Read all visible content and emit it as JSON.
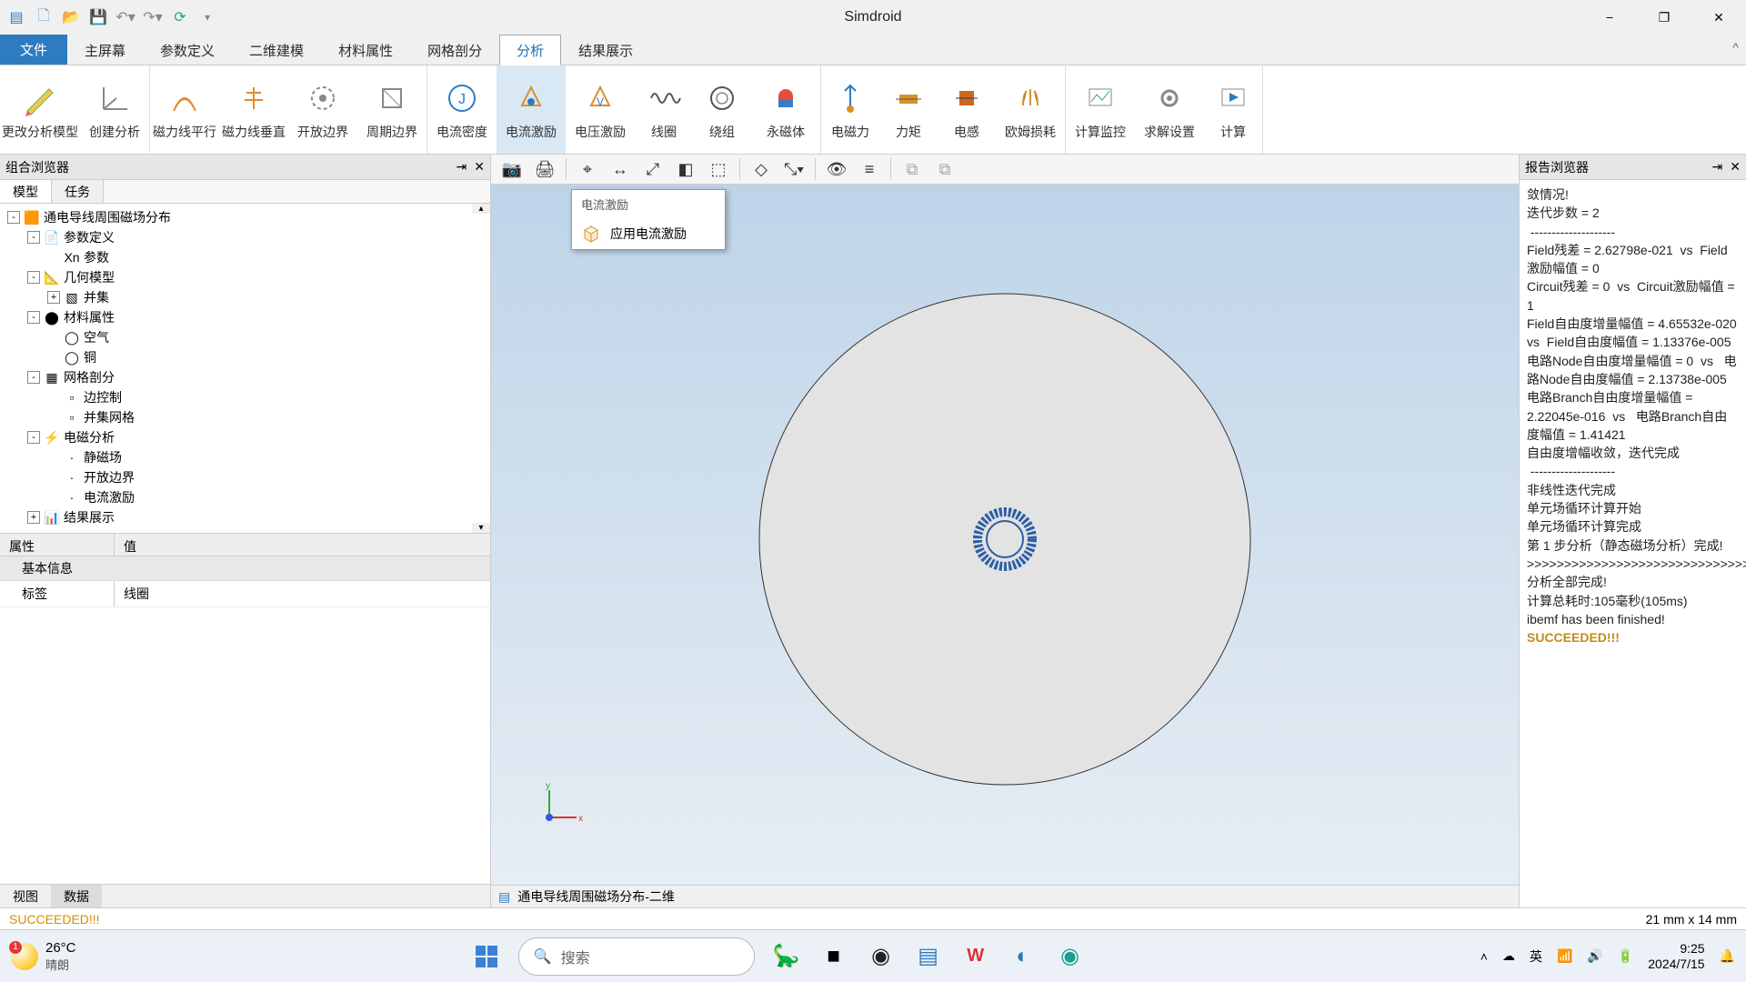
{
  "app": {
    "title": "Simdroid"
  },
  "qat": [
    "logo",
    "new",
    "open",
    "save",
    "undo",
    "redo",
    "refresh",
    "more"
  ],
  "menus": {
    "file": "文件",
    "items": [
      "主屏幕",
      "参数定义",
      "二维建模",
      "材料属性",
      "网格剖分",
      "分析",
      "结果展示"
    ],
    "active_index": 5
  },
  "ribbon": [
    {
      "label": "更改分析模型",
      "icon": "pencil-color"
    },
    {
      "label": "创建分析",
      "icon": "axes"
    },
    {
      "sep": true
    },
    {
      "label": "磁力线平行",
      "icon": "field-parallel"
    },
    {
      "label": "磁力线垂直",
      "icon": "field-perp"
    },
    {
      "label": "开放边界",
      "icon": "open-boundary"
    },
    {
      "label": "周期边界",
      "icon": "periodic"
    },
    {
      "sep": true
    },
    {
      "label": "电流密度",
      "icon": "current-density"
    },
    {
      "label": "电流激励",
      "icon": "current-exc",
      "active": true
    },
    {
      "label": "电压激励",
      "icon": "voltage-exc"
    },
    {
      "label": "线圈",
      "icon": "coil"
    },
    {
      "label": "绕组",
      "icon": "winding"
    },
    {
      "label": "永磁体",
      "icon": "magnet"
    },
    {
      "sep": true
    },
    {
      "label": "电磁力",
      "icon": "em-force"
    },
    {
      "label": "力矩",
      "icon": "torque"
    },
    {
      "label": "电感",
      "icon": "inductance"
    },
    {
      "label": "欧姆损耗",
      "icon": "ohmic"
    },
    {
      "sep": true
    },
    {
      "label": "计算监控",
      "icon": "monitor"
    },
    {
      "label": "求解设置",
      "icon": "solver-settings"
    },
    {
      "label": "计算",
      "icon": "run"
    }
  ],
  "left_panel": {
    "title": "组合浏览器",
    "subtabs": [
      "模型",
      "任务"
    ],
    "tree": [
      {
        "depth": 0,
        "toggle": "-",
        "icon": "🟧",
        "label": "通电导线周围磁场分布"
      },
      {
        "depth": 1,
        "toggle": "-",
        "icon": "📄",
        "label": "参数定义"
      },
      {
        "depth": 2,
        "toggle": "",
        "icon": "Xn",
        "label": "参数"
      },
      {
        "depth": 1,
        "toggle": "-",
        "icon": "📐",
        "label": "几何模型"
      },
      {
        "depth": 2,
        "toggle": "+",
        "icon": "▧",
        "label": "并集"
      },
      {
        "depth": 1,
        "toggle": "-",
        "icon": "⬤",
        "label": "材料属性"
      },
      {
        "depth": 2,
        "toggle": "",
        "icon": "◯",
        "label": "空气"
      },
      {
        "depth": 2,
        "toggle": "",
        "icon": "◯",
        "label": "铜"
      },
      {
        "depth": 1,
        "toggle": "-",
        "icon": "▦",
        "label": "网格剖分"
      },
      {
        "depth": 2,
        "toggle": "",
        "icon": "▫",
        "label": "边控制"
      },
      {
        "depth": 2,
        "toggle": "",
        "icon": "▫",
        "label": "并集网格"
      },
      {
        "depth": 1,
        "toggle": "-",
        "icon": "⚡",
        "label": "电磁分析"
      },
      {
        "depth": 2,
        "toggle": "",
        "icon": "·",
        "label": "静磁场"
      },
      {
        "depth": 2,
        "toggle": "",
        "icon": "·",
        "label": "开放边界"
      },
      {
        "depth": 2,
        "toggle": "",
        "icon": "·",
        "label": "电流激励"
      },
      {
        "depth": 1,
        "toggle": "+",
        "icon": "📊",
        "label": "结果展示"
      }
    ],
    "prop_headers": [
      "属性",
      "值"
    ],
    "prop_section": "基本信息",
    "prop_rows": [
      [
        "标签",
        "线圈"
      ]
    ],
    "bottom_tabs": [
      "视图",
      "数据"
    ]
  },
  "canvas": {
    "dropdown": {
      "title": "电流激励",
      "item": "应用电流激励"
    },
    "doc_tab": "通电导线周围磁场分布-二维",
    "axes": [
      "x",
      "y",
      "z"
    ]
  },
  "report": {
    "title": "报告浏览器",
    "lines": [
      "敛情况!",
      "迭代步数 = 2",
      " --------------------",
      "",
      "Field残差 = 2.62798e-021  vs  Field激励幅值 = 0",
      "Circuit残差 = 0  vs  Circuit激励幅值 = 1",
      "Field自由度增量幅值 = 4.65532e-020  vs  Field自由度幅值 = 1.13376e-005",
      "电路Node自由度增量幅值 = 0  vs   电路Node自由度幅值 = 2.13738e-005",
      "电路Branch自由度增量幅值 = 2.22045e-016  vs   电路Branch自由度幅值 = 1.41421",
      "自由度增幅收敛，迭代完成",
      " --------------------",
      "非线性迭代完成",
      "单元场循环计算开始",
      "",
      "单元场循环计算完成",
      "",
      "第 1 步分析（静态磁场分析）完成!",
      "",
      ">>>>>>>>>>>>>>>>>>>>>>>>>>>>>>>>>>>>>>>>>>",
      "分析全部完成!",
      "计算总耗时:105毫秒(105ms)",
      "ibemf has been finished!"
    ],
    "succeeded": "SUCCEEDED!!!"
  },
  "status": {
    "left": "SUCCEEDED!!!",
    "right": "21 mm x 14 mm"
  },
  "taskbar": {
    "weather": {
      "temp": "26°C",
      "desc": "晴朗"
    },
    "search_placeholder": "搜索",
    "tray": {
      "ime": "英"
    },
    "clock": {
      "time": "9:25",
      "date": "2024/7/15"
    }
  }
}
